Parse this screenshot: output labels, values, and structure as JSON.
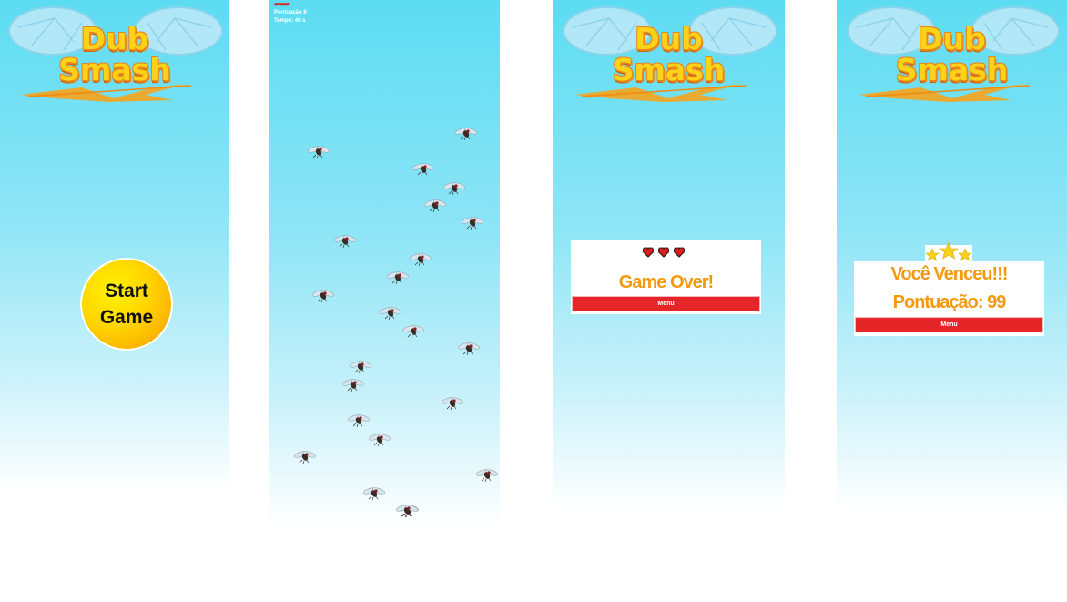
{
  "colors": {
    "sky_top": "#5cdcf2",
    "sky_bottom": "#ffffff",
    "accent_orange": "#f39a10",
    "menu_red": "#e52528",
    "heart_red": "#e01b1b",
    "start_yellow": "#ffd400"
  },
  "logo": {
    "line1": "Dub",
    "line2": "Smash"
  },
  "start_screen": {
    "start_line1": "Start",
    "start_line2": "Game"
  },
  "game_screen": {
    "hearts": "♥♥♥♥♥",
    "score_text": "Pontuação 8",
    "time_text": "Tempo: 49 s",
    "fly_count": 24
  },
  "game_over_screen": {
    "title": "Game Over!",
    "menu_label": "Menu",
    "lives_icons": 3
  },
  "win_screen": {
    "title": "Você Venceu!!!",
    "score_text": "Pontuação: 99",
    "menu_label": "Menu",
    "stars": 3
  }
}
